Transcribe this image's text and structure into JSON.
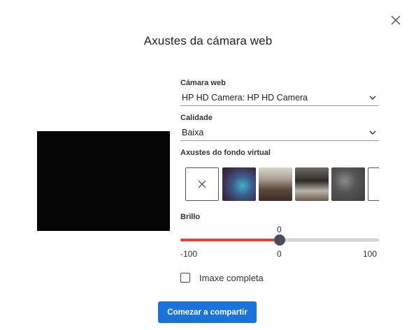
{
  "dialog": {
    "title": "Axustes da cámara web"
  },
  "camera": {
    "label": "Cámara web",
    "selected": "HP HD Camera: HP HD Camera"
  },
  "quality": {
    "label": "Calidade",
    "selected": "Baixa"
  },
  "virtual_background": {
    "label": "Axustes do fondo virtual",
    "options": [
      {
        "name": "none",
        "icon": "close-icon"
      },
      {
        "name": "blur"
      },
      {
        "name": "room-1"
      },
      {
        "name": "room-2"
      },
      {
        "name": "texture"
      },
      {
        "name": "partial"
      }
    ]
  },
  "brightness": {
    "label": "Brillo",
    "value": 0,
    "value_text": "0",
    "min": -100,
    "min_text": "-100",
    "max": 100,
    "max_text": "100",
    "mid_text": "0",
    "fill_color": "#e0443a",
    "knob_color": "#4c4c5a"
  },
  "fullscreen": {
    "label": "Imaxe completa",
    "checked": false
  },
  "actions": {
    "start_sharing": "Comezar a compartir",
    "accent": "#1a73d9"
  }
}
